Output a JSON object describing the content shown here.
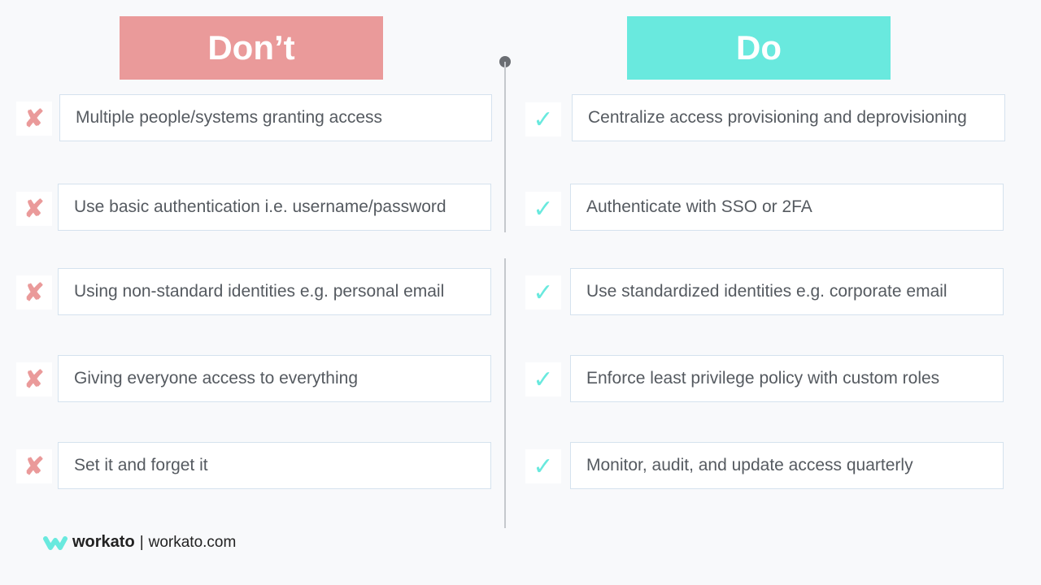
{
  "headers": {
    "dont": "Don’t",
    "do": "Do"
  },
  "colors": {
    "dont": "#ea9a9a",
    "do": "#69e9de"
  },
  "icons": {
    "dont": "✘",
    "do": "✓"
  },
  "dont_items": [
    "Multiple people/systems granting access",
    "Use basic authentication i.e. username/password",
    "Using non-standard identities e.g. personal email",
    "Giving everyone access to everything",
    "Set it and forget it"
  ],
  "do_items": [
    "Centralize access provisioning and deprovisioning",
    "Authenticate with SSO or 2FA",
    "Use standardized identities e.g. corporate email",
    "Enforce least privilege policy with custom roles",
    "Monitor, audit, and update access quarterly"
  ],
  "footer": {
    "brand": "workato",
    "separator": "|",
    "url": "workato.com"
  }
}
